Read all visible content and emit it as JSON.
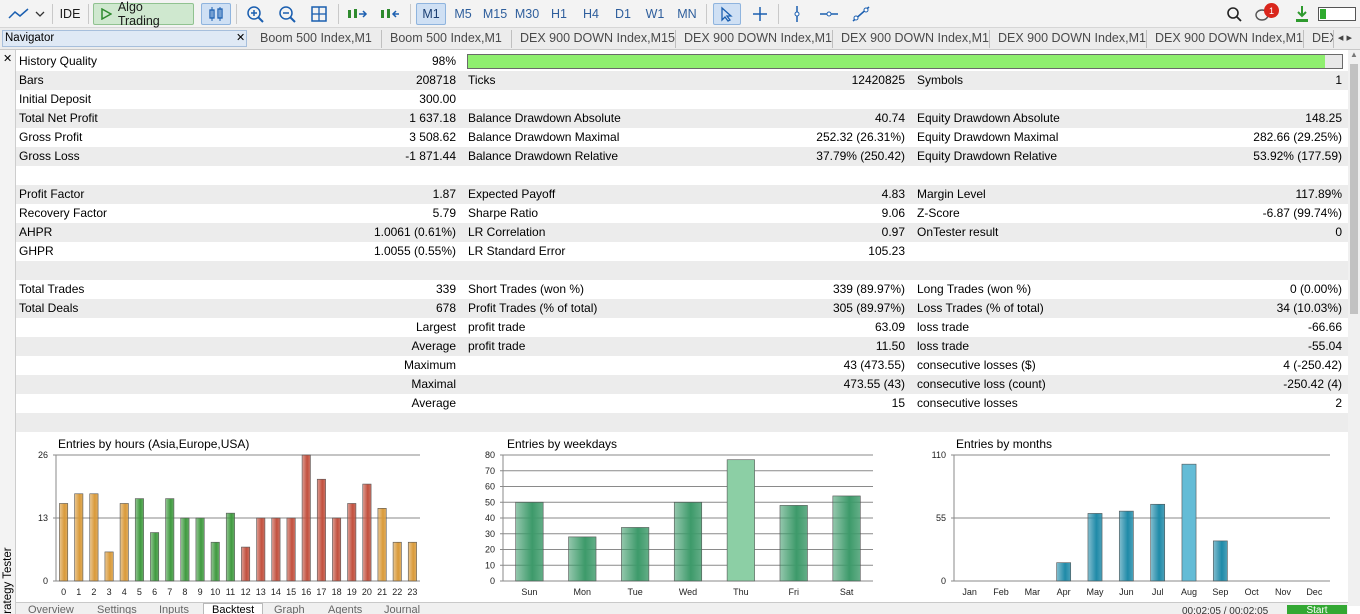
{
  "toolbar": {
    "ide_label": "IDE",
    "algo_label": "Algo Trading",
    "timeframes": [
      "M1",
      "M5",
      "M15",
      "M30",
      "H1",
      "H4",
      "D1",
      "W1",
      "MN"
    ],
    "active_timeframe": "M1",
    "notifications": "1",
    "accent_color": "#1b5fb0"
  },
  "navigator": {
    "label": "Navigator"
  },
  "chart_tabs": [
    "Boom 500 Index,M1",
    "Boom 500 Index,M1",
    "DEX 900 DOWN Index,M15",
    "DEX 900 DOWN Index,M1",
    "DEX 900 DOWN Index,M1",
    "DEX 900 DOWN Index,M1",
    "DEX 900 DOWN Index,M1",
    "DEX 900 DOWN Index,M1"
  ],
  "side_panel_label": "Strategy Tester",
  "report": {
    "rows": [
      [
        "History Quality",
        "98%",
        "",
        "",
        "",
        ""
      ],
      [
        "Bars",
        "208718",
        "Ticks",
        "12420825",
        "Symbols",
        "1"
      ],
      [
        "Initial Deposit",
        "300.00",
        "",
        "",
        "",
        ""
      ],
      [
        "Total Net Profit",
        "1 637.18",
        "Balance Drawdown Absolute",
        "40.74",
        "Equity Drawdown Absolute",
        "148.25"
      ],
      [
        "Gross Profit",
        "3 508.62",
        "Balance Drawdown Maximal",
        "252.32 (26.31%)",
        "Equity Drawdown Maximal",
        "282.66 (29.25%)"
      ],
      [
        "Gross Loss",
        "-1 871.44",
        "Balance Drawdown Relative",
        "37.79% (250.42)",
        "Equity Drawdown Relative",
        "53.92% (177.59)"
      ],
      [
        "",
        "",
        "",
        "",
        "",
        ""
      ],
      [
        "Profit Factor",
        "1.87",
        "Expected Payoff",
        "4.83",
        "Margin Level",
        "117.89%"
      ],
      [
        "Recovery Factor",
        "5.79",
        "Sharpe Ratio",
        "9.06",
        "Z-Score",
        "-6.87 (99.74%)"
      ],
      [
        "AHPR",
        "1.0061 (0.61%)",
        "LR Correlation",
        "0.97",
        "OnTester result",
        "0"
      ],
      [
        "GHPR",
        "1.0055 (0.55%)",
        "LR Standard Error",
        "105.23",
        "",
        ""
      ],
      [
        "",
        "",
        "",
        "",
        "",
        ""
      ],
      [
        "Total Trades",
        "339",
        "Short Trades (won %)",
        "339 (89.97%)",
        "Long Trades (won %)",
        "0 (0.00%)"
      ],
      [
        "Total Deals",
        "678",
        "Profit Trades (% of total)",
        "305 (89.97%)",
        "Loss Trades (% of total)",
        "34 (10.03%)"
      ],
      [
        "",
        "Largest",
        "profit trade",
        "63.09",
        "loss trade",
        "-66.66"
      ],
      [
        "",
        "Average",
        "profit trade",
        "11.50",
        "loss trade",
        "-55.04"
      ],
      [
        "",
        "Maximum",
        "",
        "43 (473.55)",
        "consecutive losses ($)",
        "4 (-250.42)"
      ],
      [
        "",
        "Maximal",
        "",
        "473.55 (43)",
        "consecutive loss (count)",
        "-250.42 (4)"
      ],
      [
        "",
        "Average",
        "",
        "15",
        "consecutive losses",
        "2"
      ],
      [
        "",
        "",
        "",
        "",
        "",
        ""
      ]
    ],
    "history_quality": 0.98,
    "quality_color": "#8fef6f"
  },
  "chart_data": [
    {
      "type": "bar",
      "title": "Entries by hours (Asia,Europe,USA)",
      "categories": [
        "0",
        "1",
        "2",
        "3",
        "4",
        "5",
        "6",
        "7",
        "8",
        "9",
        "10",
        "11",
        "12",
        "13",
        "14",
        "15",
        "16",
        "17",
        "18",
        "19",
        "20",
        "21",
        "22",
        "23"
      ],
      "values": [
        16,
        18,
        18,
        6,
        16,
        17,
        10,
        17,
        13,
        13,
        8,
        14,
        7,
        13,
        13,
        13,
        26,
        21,
        13,
        16,
        20,
        15,
        8,
        8
      ],
      "yticks": [
        0,
        13,
        26
      ],
      "ylim": [
        0,
        26
      ],
      "colors": {
        "asia": "#d99a3a",
        "europe": "#3f9a3f",
        "usa": "#c2503e"
      }
    },
    {
      "type": "bar",
      "title": "Entries by weekdays",
      "categories": [
        "Sun",
        "Mon",
        "Tue",
        "Wed",
        "Thu",
        "Fri",
        "Sat"
      ],
      "values": [
        50,
        28,
        34,
        50,
        77,
        48,
        54
      ],
      "yticks": [
        0,
        10,
        20,
        30,
        40,
        50,
        60,
        70,
        80
      ],
      "ylim": [
        0,
        80
      ],
      "colors": {
        "bar": "#3d9a6a",
        "highlight": "#8ccfa5"
      }
    },
    {
      "type": "bar",
      "title": "Entries by months",
      "categories": [
        "Jan",
        "Feb",
        "Mar",
        "Apr",
        "May",
        "Jun",
        "Jul",
        "Aug",
        "Sep",
        "Oct",
        "Nov",
        "Dec"
      ],
      "values": [
        0,
        0,
        0,
        16,
        59,
        61,
        67,
        102,
        35,
        0,
        0,
        0
      ],
      "yticks": [
        0,
        55,
        110
      ],
      "ylim": [
        0,
        110
      ],
      "colors": {
        "bar": "#1f8aa8",
        "highlight": "#64bcd6"
      }
    }
  ],
  "bottom_tabs": [
    "Overview",
    "Settings",
    "Inputs",
    "Backtest",
    "Graph",
    "Agents",
    "Journal"
  ],
  "active_bottom_tab": "Backtest",
  "elapsed": "00:02:05 / 00:02:05",
  "start_label": "Start"
}
